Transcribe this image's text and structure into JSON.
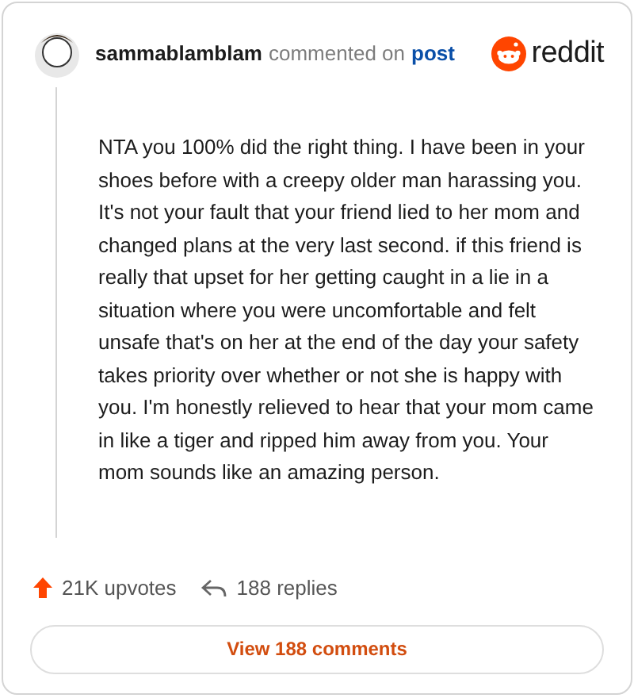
{
  "comment": {
    "author": "sammablamblam",
    "action": "commented on",
    "link": "post",
    "brand": "reddit",
    "body": "NTA you 100% did the right thing. I have been in your shoes before with a creepy older man harassing you. It's not your fault that your friend lied to her mom and changed plans at the very last second. if this friend is really that upset for her getting caught in a lie in a situation where you were uncomfortable and felt unsafe that's on her at the end of the day your safety takes priority over whether or not she is happy with you. I'm honestly relieved to hear that your mom came in like a tiger and ripped him away from you. Your mom sounds like an amazing person.",
    "upvotes": "21K upvotes",
    "replies": "188 replies",
    "button": "View 188 comments"
  }
}
